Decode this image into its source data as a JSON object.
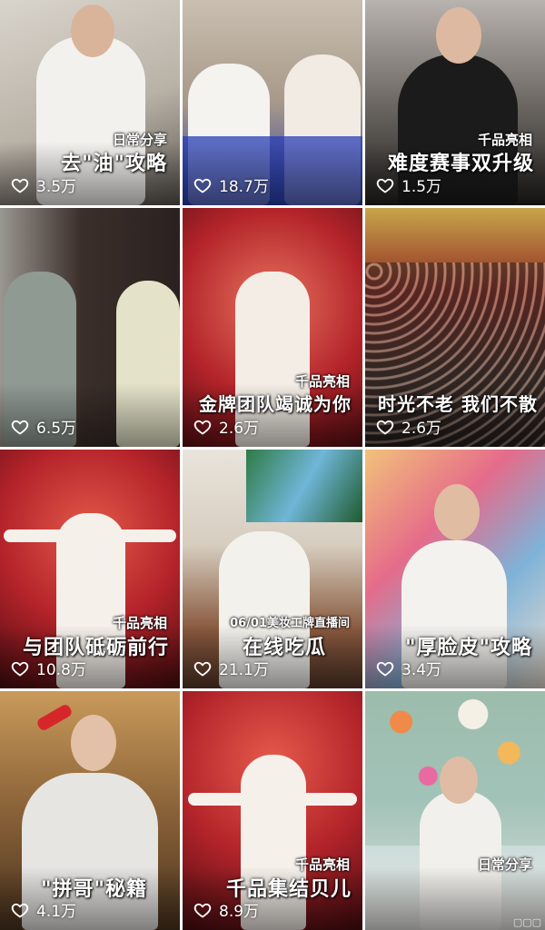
{
  "videos": [
    {
      "tag": "日常分享",
      "caption": "去\"油\"攻略",
      "likes": "3.5万"
    },
    {
      "tag": "",
      "caption": "",
      "likes": "18.7万"
    },
    {
      "tag": "千品亮相",
      "caption": "难度赛事双升级",
      "likes": "1.5万"
    },
    {
      "tag": "",
      "caption": "",
      "likes": "6.5万"
    },
    {
      "tag": "千品亮相",
      "caption": "金牌团队竭诚为你",
      "likes": "2.6万"
    },
    {
      "tag": "",
      "caption": "时光不老 我们不散",
      "likes": "2.6万"
    },
    {
      "tag": "千品亮相",
      "caption": "与团队砥砺前行",
      "likes": "10.8万"
    },
    {
      "tag": "06/01美妆工牌直播间",
      "caption": "在线吃瓜",
      "likes": "21.1万"
    },
    {
      "tag": "",
      "caption": "\"厚脸皮\"攻略",
      "likes": "3.4万"
    },
    {
      "tag": "",
      "caption": "\"拼哥\"秘籍",
      "likes": "4.1万"
    },
    {
      "tag": "千品亮相",
      "caption": "千品集结贝儿",
      "likes": "8.9万"
    },
    {
      "tag": "日常分享",
      "caption": "",
      "likes": ""
    }
  ],
  "colors": {
    "text": "#ffffff",
    "like_icon": "#ffffff"
  },
  "icons": {
    "like": "heart-outline-icon"
  }
}
